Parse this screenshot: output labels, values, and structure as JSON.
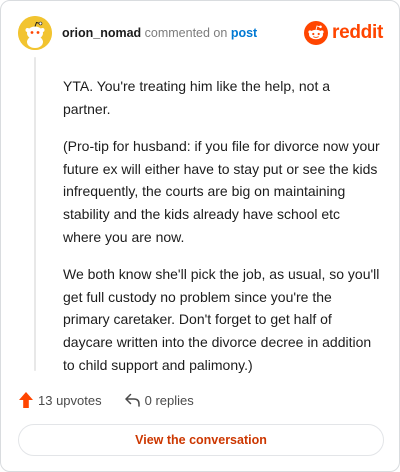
{
  "header": {
    "username": "orion_nomad",
    "action_text": "commented on",
    "post_link": "post",
    "brand_name": "reddit",
    "avatar_icon": "snoo-avatar-icon",
    "brand_icon": "reddit-logo-icon"
  },
  "comment": {
    "paragraphs": [
      "YTA. You're treating him like the help, not a partner.",
      "(Pro-tip for husband: if you file for divorce now your future ex will either have to stay put or see the kids infrequently, the courts are big on maintaining stability and the kids already have school etc where you are now.",
      "We both know she'll pick the job, as usual, so you'll get full custody no problem since you're the primary caretaker. Don't forget to get half of daycare written into the divorce decree in addition to child support and palimony.)"
    ]
  },
  "actions": {
    "upvotes_label": "13 upvotes",
    "replies_label": "0 replies",
    "upvote_icon": "upvote-arrow-icon",
    "reply_icon": "reply-arrow-icon"
  },
  "cta": {
    "label": "View the conversation"
  },
  "colors": {
    "accent": "#ff4500",
    "link": "#0079d3",
    "cta_text": "#cc3700",
    "avatar_bg": "#f2c430"
  }
}
